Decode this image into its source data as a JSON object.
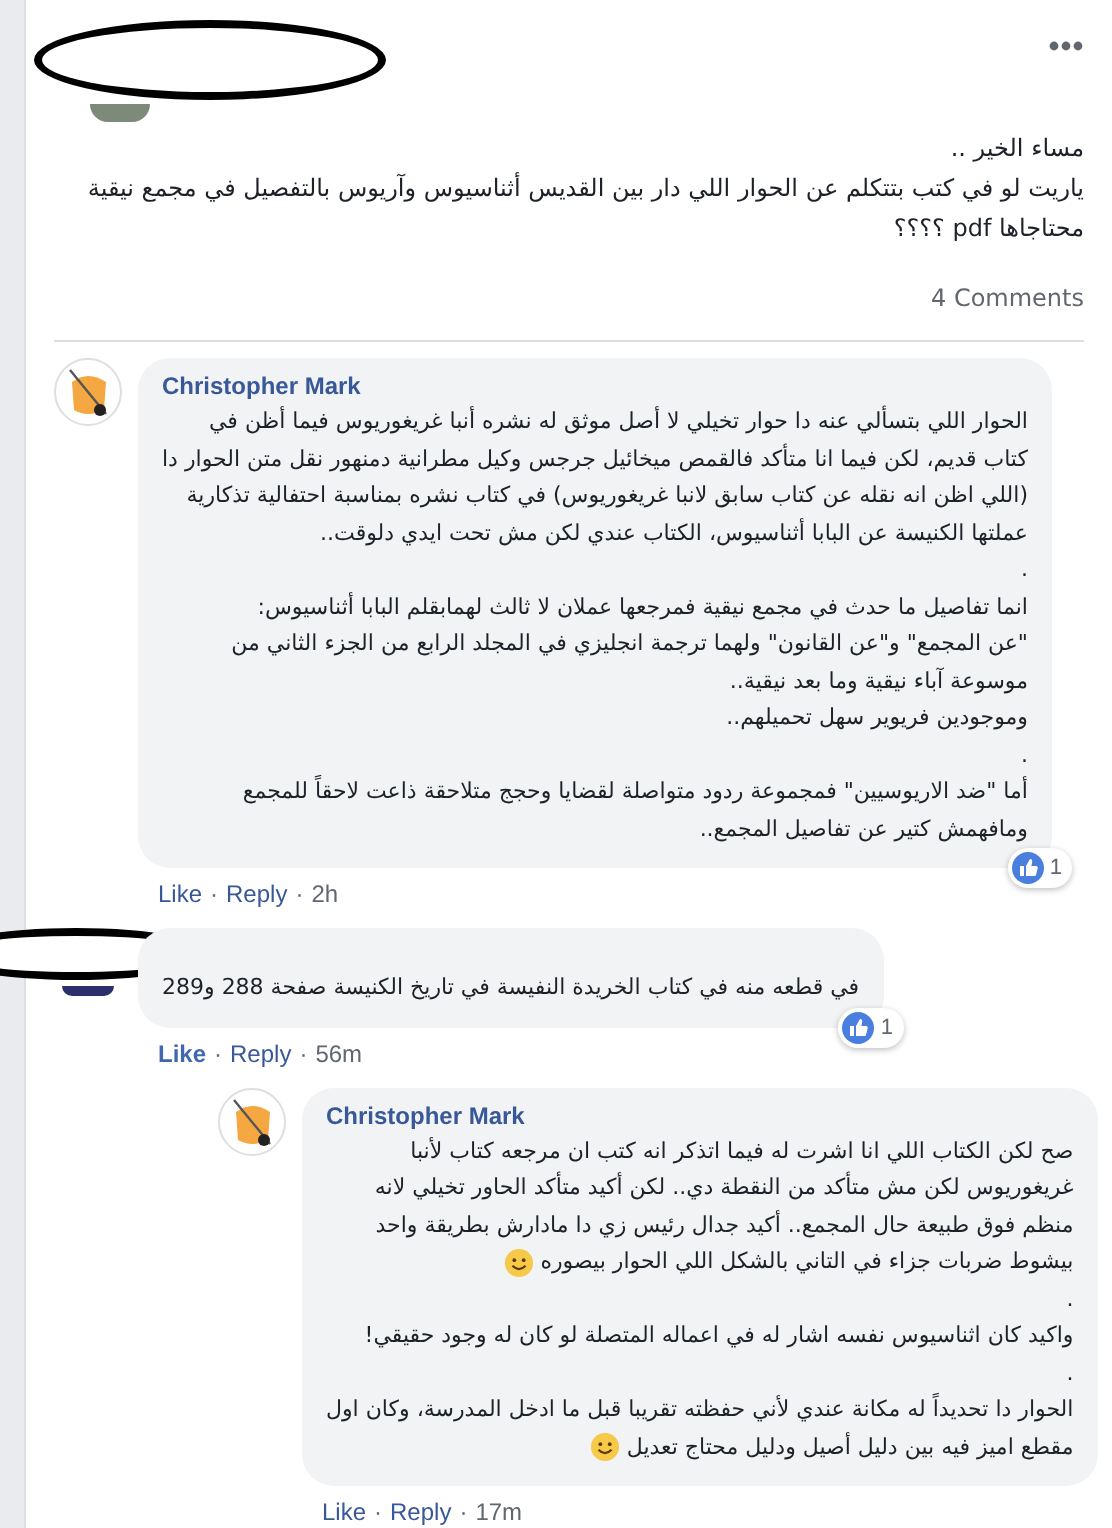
{
  "post": {
    "author_redacted": true,
    "lines": [
      {
        "text": "مساء الخير .."
      },
      {
        "text": "ياريت لو في كتب بتتكلم عن الحوار اللي دار بين القديس أثناسيوس وآريوس بالتفصيل في مجمع نيقية"
      },
      {
        "text": "محتاجاها pdf ؟؟؟؟"
      }
    ],
    "comment_count": "4 Comments"
  },
  "comments": [
    {
      "kind": "comment",
      "name": "Christopher Mark",
      "avatar": {
        "kind": "cartoon"
      },
      "redacted": false,
      "liked": false,
      "reactions": "1",
      "actions": {
        "like": "Like",
        "dot_1": "·",
        "reply": "Reply",
        "dot_2": "·",
        "time": "2h"
      },
      "lines": [
        {
          "text": "الحوار اللي بتسألي عنه دا حوار تخيلي لا أصل موثق له نشره أنبا غريغوريوس فيما أظن في"
        },
        {
          "text": "كتاب قديم، لكن فيما انا متأكد فالقمص ميخائيل جرجس وكيل مطرانية دمنهور نقل متن الحوار دا"
        },
        {
          "text": "(اللي اظن انه نقله عن كتاب سابق لانبا غريغوريوس) في كتاب نشره بمناسبة احتفالية تذكارية"
        },
        {
          "text": "عملتها الكنيسة عن البابا أثناسيوس، الكتاب عندي لكن مش تحت ايدي دلوقت.."
        },
        {
          "text": "."
        },
        {
          "text": "انما تفاصيل ما حدث في مجمع نيقية فمرجعها عملان لا ثالث لهمابقلم البابا أثناسيوس:"
        },
        {
          "text": "\"عن المجمع\" و\"عن القانون\" ولهما ترجمة انجليزي في المجلد الرابع من الجزء الثاني من"
        },
        {
          "text": "موسوعة آباء نيقية وما بعد نيقية.."
        },
        {
          "text": "وموجودين فريوير سهل تحميلهم.."
        },
        {
          "text": "."
        },
        {
          "text": "أما \"ضد الاريوسيين\" فمجموعة ردود متواصلة لقضايا وحجج متلاحقة ذاعت لاحقاً للمجمع"
        },
        {
          "text": "ومافهمش كتير عن تفاصيل المجمع.."
        }
      ]
    },
    {
      "kind": "comment",
      "avatar": {
        "kind": "plain"
      },
      "redacted": true,
      "liked": true,
      "reactions": "1",
      "actions": {
        "like": "Like",
        "dot_1": "·",
        "reply": "Reply",
        "dot_2": "·",
        "time": "56m"
      },
      "lines": [
        {
          "text": "في قطعه منه في كتاب الخريدة النفيسة في تاريخ الكنيسة صفحة 288 و289"
        }
      ]
    },
    {
      "kind": "reply",
      "name": "Christopher Mark",
      "avatar": {
        "kind": "cartoon"
      },
      "redacted": false,
      "liked": false,
      "actions": {
        "like": "Like",
        "dot_1": "·",
        "reply": "Reply",
        "dot_2": "·",
        "time": "17m"
      },
      "lines": [
        {
          "text": "صح لكن الكتاب اللي انا اشرت له فيما اتذكر انه كتب ان مرجعه كتاب لأنبا"
        },
        {
          "text": "غريغوريوس لكن مش متأكد من النقطة دي.. لكن أكيد متأكد الحاور تخيلي لانه"
        },
        {
          "text": "منظم فوق طبيعة حال المجمع.. أكيد جدال رئيس زي دا مادارش بطريقة واحد"
        },
        {
          "text": "بيشوط ضربات جزاء في التاني بالشكل اللي الحوار بيصوره",
          "emoji": true
        },
        {
          "text": "."
        },
        {
          "text": "واكيد كان اثناسيوس نفسه اشار له في اعماله المتصلة لو كان له وجود حقيقي!"
        },
        {
          "text": "."
        },
        {
          "text": "الحوار دا تحديداً له مكانة عندي لأني حفظته تقريبا قبل ما ادخل المدرسة، وكان اول"
        },
        {
          "text": "مقطع اميز فيه بين دليل أصيل ودليل محتاج تعديل",
          "emoji": true
        }
      ]
    }
  ]
}
